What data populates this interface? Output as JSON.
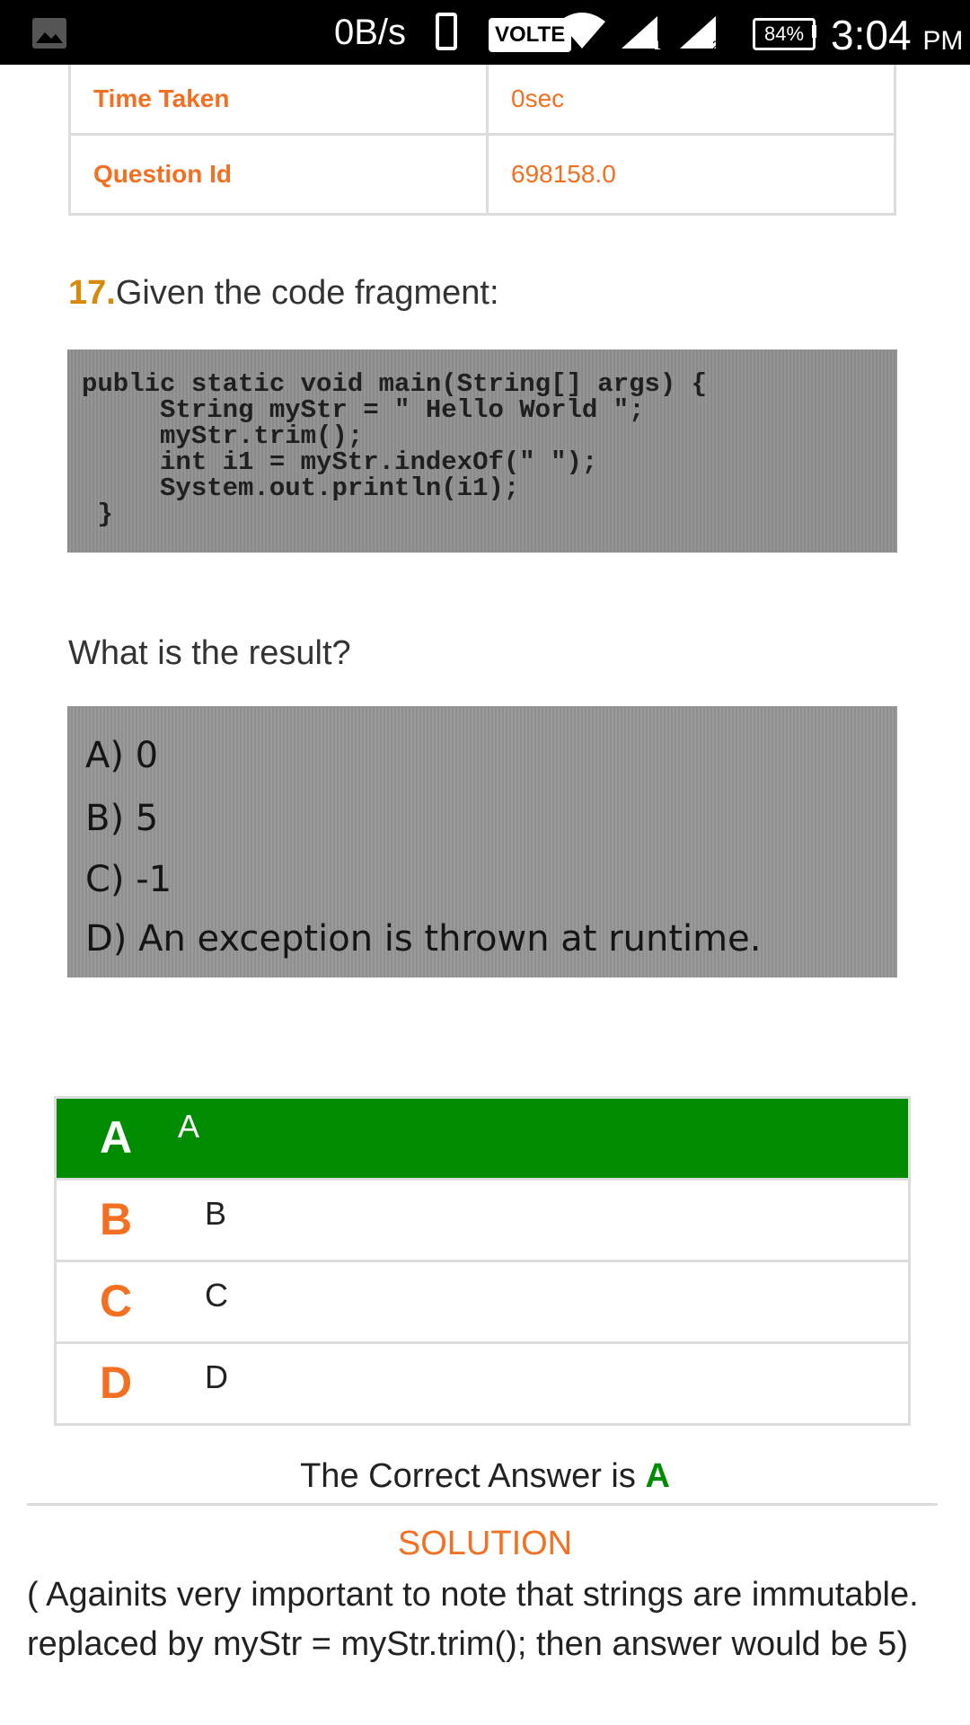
{
  "status_bar": {
    "speed": "0B/s",
    "volte": "VOLTE",
    "sim1": "1",
    "sim2": "2",
    "battery": "84%",
    "time": "3:04",
    "ampm": "PM",
    "icons": [
      "gallery-icon",
      "phone-icon",
      "wifi-icon",
      "signal-icon",
      "battery-icon"
    ]
  },
  "info": [
    {
      "label": "Time Taken",
      "value": "0sec"
    },
    {
      "label": "Question Id",
      "value": "698158.0"
    }
  ],
  "question": {
    "number": "17.",
    "text": "Given the code fragment:",
    "code": "public static void main(String[] args) {\n     String myStr = \" Hello World \";\n     myStr.trim();\n     int i1 = myStr.indexOf(\" \");\n     System.out.println(i1);\n }",
    "prompt": "What is the result?",
    "options": [
      "A) 0",
      "B) 5",
      "C) -1",
      "D) An exception is thrown at runtime."
    ]
  },
  "choices": [
    {
      "letter": "A",
      "text": "A",
      "selected": true
    },
    {
      "letter": "B",
      "text": "B",
      "selected": false
    },
    {
      "letter": "C",
      "text": "C",
      "selected": false
    },
    {
      "letter": "D",
      "text": "D",
      "selected": false
    }
  ],
  "answer": {
    "prefix": "The Correct Answer is ",
    "value": "A"
  },
  "solution": {
    "heading": "SOLUTION",
    "line1": "( Againits very important to note that strings are immutable.",
    "line2": "replaced by myStr = myStr.trim(); then answer would be 5)"
  },
  "colors": {
    "accent_orange": "#f36f21",
    "correct_green": "#008c00",
    "question_number": "#d8890a"
  }
}
